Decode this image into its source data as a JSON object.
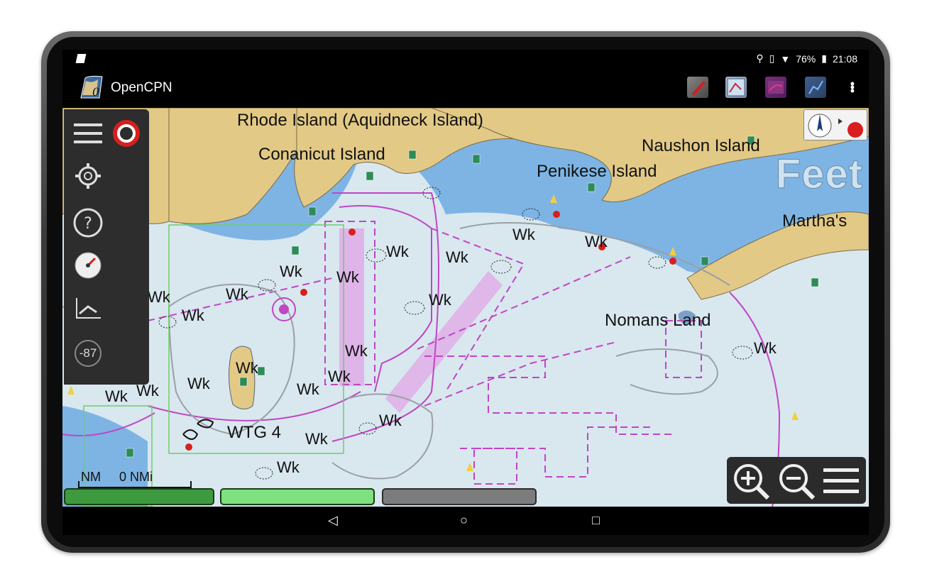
{
  "status_bar": {
    "battery": "76%",
    "time": "21:08"
  },
  "app_bar": {
    "title": "OpenCPN"
  },
  "map": {
    "labels": {
      "rhode_island": "Rhode Island (Aquidneck Island)",
      "conanicut": "Conanicut Island",
      "naushon": "Naushon Island",
      "penikese": "Penikese Island",
      "marthas": "Martha's",
      "nomans": "Nomans Land",
      "wtg": "WTG 4"
    },
    "wrecks": "Wk",
    "units": "Feet",
    "scale": {
      "left": "NM",
      "right": "0 NMi"
    },
    "heading": "-87"
  },
  "colors": {
    "land": "#e2c986",
    "shallow": "#7db4e4",
    "deep": "#d9e7ef",
    "route": "#c046c4",
    "accent_red": "#d91e1e"
  }
}
